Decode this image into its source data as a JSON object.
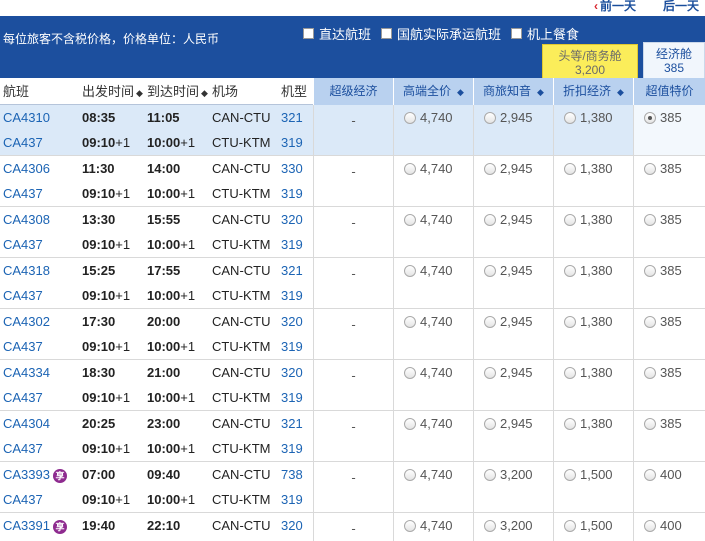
{
  "nav": {
    "prev_day": "前一天",
    "next_day": "后一天"
  },
  "banner": {
    "note": "每位旅客不含税价格，价格单位：人民币",
    "filters": [
      {
        "label": "直达航班",
        "checked": false
      },
      {
        "label": "国航实际承运航班",
        "checked": false
      },
      {
        "label": "机上餐食",
        "checked": false
      }
    ],
    "cabins": [
      {
        "name": "头等/商务舱",
        "price": "3,200"
      },
      {
        "name": "经济舱",
        "price": "385"
      }
    ]
  },
  "columns": {
    "flight": "航班",
    "dep_time": "出发时间",
    "arr_time": "到达时间",
    "airport": "机场",
    "model": "机型",
    "sort_icon": "◆",
    "fares": [
      "超级经济",
      "高端全价",
      "商旅知音",
      "折扣经济",
      "超值特价"
    ]
  },
  "rows": [
    {
      "selected": true,
      "fares": [
        "-",
        "4,740",
        "2,945",
        "1,380",
        "385"
      ],
      "legs": [
        {
          "flight": "CA4310",
          "dep": "08:35",
          "arr": "11:05",
          "airport": "CAN-CTU",
          "model": "321"
        },
        {
          "flight": "CA437",
          "dep": "09:10",
          "dep_plus": "+1",
          "arr": "10:00",
          "arr_plus": "+1",
          "airport": "CTU-KTM",
          "model": "319"
        }
      ]
    },
    {
      "selected": false,
      "fares": [
        "-",
        "4,740",
        "2,945",
        "1,380",
        "385"
      ],
      "legs": [
        {
          "flight": "CA4306",
          "dep": "11:30",
          "arr": "14:00",
          "airport": "CAN-CTU",
          "model": "330"
        },
        {
          "flight": "CA437",
          "dep": "09:10",
          "dep_plus": "+1",
          "arr": "10:00",
          "arr_plus": "+1",
          "airport": "CTU-KTM",
          "model": "319"
        }
      ]
    },
    {
      "selected": false,
      "fares": [
        "-",
        "4,740",
        "2,945",
        "1,380",
        "385"
      ],
      "legs": [
        {
          "flight": "CA4308",
          "dep": "13:30",
          "arr": "15:55",
          "airport": "CAN-CTU",
          "model": "320"
        },
        {
          "flight": "CA437",
          "dep": "09:10",
          "dep_plus": "+1",
          "arr": "10:00",
          "arr_plus": "+1",
          "airport": "CTU-KTM",
          "model": "319"
        }
      ]
    },
    {
      "selected": false,
      "fares": [
        "-",
        "4,740",
        "2,945",
        "1,380",
        "385"
      ],
      "legs": [
        {
          "flight": "CA4318",
          "dep": "15:25",
          "arr": "17:55",
          "airport": "CAN-CTU",
          "model": "321"
        },
        {
          "flight": "CA437",
          "dep": "09:10",
          "dep_plus": "+1",
          "arr": "10:00",
          "arr_plus": "+1",
          "airport": "CTU-KTM",
          "model": "319"
        }
      ]
    },
    {
      "selected": false,
      "fares": [
        "-",
        "4,740",
        "2,945",
        "1,380",
        "385"
      ],
      "legs": [
        {
          "flight": "CA4302",
          "dep": "17:30",
          "arr": "20:00",
          "airport": "CAN-CTU",
          "model": "320"
        },
        {
          "flight": "CA437",
          "dep": "09:10",
          "dep_plus": "+1",
          "arr": "10:00",
          "arr_plus": "+1",
          "airport": "CTU-KTM",
          "model": "319"
        }
      ]
    },
    {
      "selected": false,
      "fares": [
        "-",
        "4,740",
        "2,945",
        "1,380",
        "385"
      ],
      "legs": [
        {
          "flight": "CA4334",
          "dep": "18:30",
          "arr": "21:00",
          "airport": "CAN-CTU",
          "model": "320"
        },
        {
          "flight": "CA437",
          "dep": "09:10",
          "dep_plus": "+1",
          "arr": "10:00",
          "arr_plus": "+1",
          "airport": "CTU-KTM",
          "model": "319"
        }
      ]
    },
    {
      "selected": false,
      "fares": [
        "-",
        "4,740",
        "2,945",
        "1,380",
        "385"
      ],
      "legs": [
        {
          "flight": "CA4304",
          "dep": "20:25",
          "arr": "23:00",
          "airport": "CAN-CTU",
          "model": "321"
        },
        {
          "flight": "CA437",
          "dep": "09:10",
          "dep_plus": "+1",
          "arr": "10:00",
          "arr_plus": "+1",
          "airport": "CTU-KTM",
          "model": "319"
        }
      ]
    },
    {
      "selected": false,
      "fares": [
        "-",
        "4,740",
        "3,200",
        "1,500",
        "400"
      ],
      "legs": [
        {
          "flight": "CA3393",
          "share": true,
          "share_badge": "享",
          "dep": "07:00",
          "arr": "09:40",
          "airport": "CAN-CTU",
          "model": "738"
        },
        {
          "flight": "CA437",
          "dep": "09:10",
          "dep_plus": "+1",
          "arr": "10:00",
          "arr_plus": "+1",
          "airport": "CTU-KTM",
          "model": "319"
        }
      ]
    },
    {
      "selected": false,
      "fares": [
        "-",
        "4,740",
        "3,200",
        "1,500",
        "400"
      ],
      "legs": [
        {
          "flight": "CA3391",
          "share": true,
          "share_badge": "享",
          "dep": "19:40",
          "arr": "22:10",
          "airport": "CAN-CTU",
          "model": "320"
        }
      ]
    }
  ],
  "colors": {
    "banner": "#1c4f9e",
    "first_tab": "#fbed5a",
    "fare_header": "#b9d1ef",
    "selected_row": "#dbe9f8",
    "link": "#1c64b4",
    "share_badge": "#8e2b8f"
  }
}
